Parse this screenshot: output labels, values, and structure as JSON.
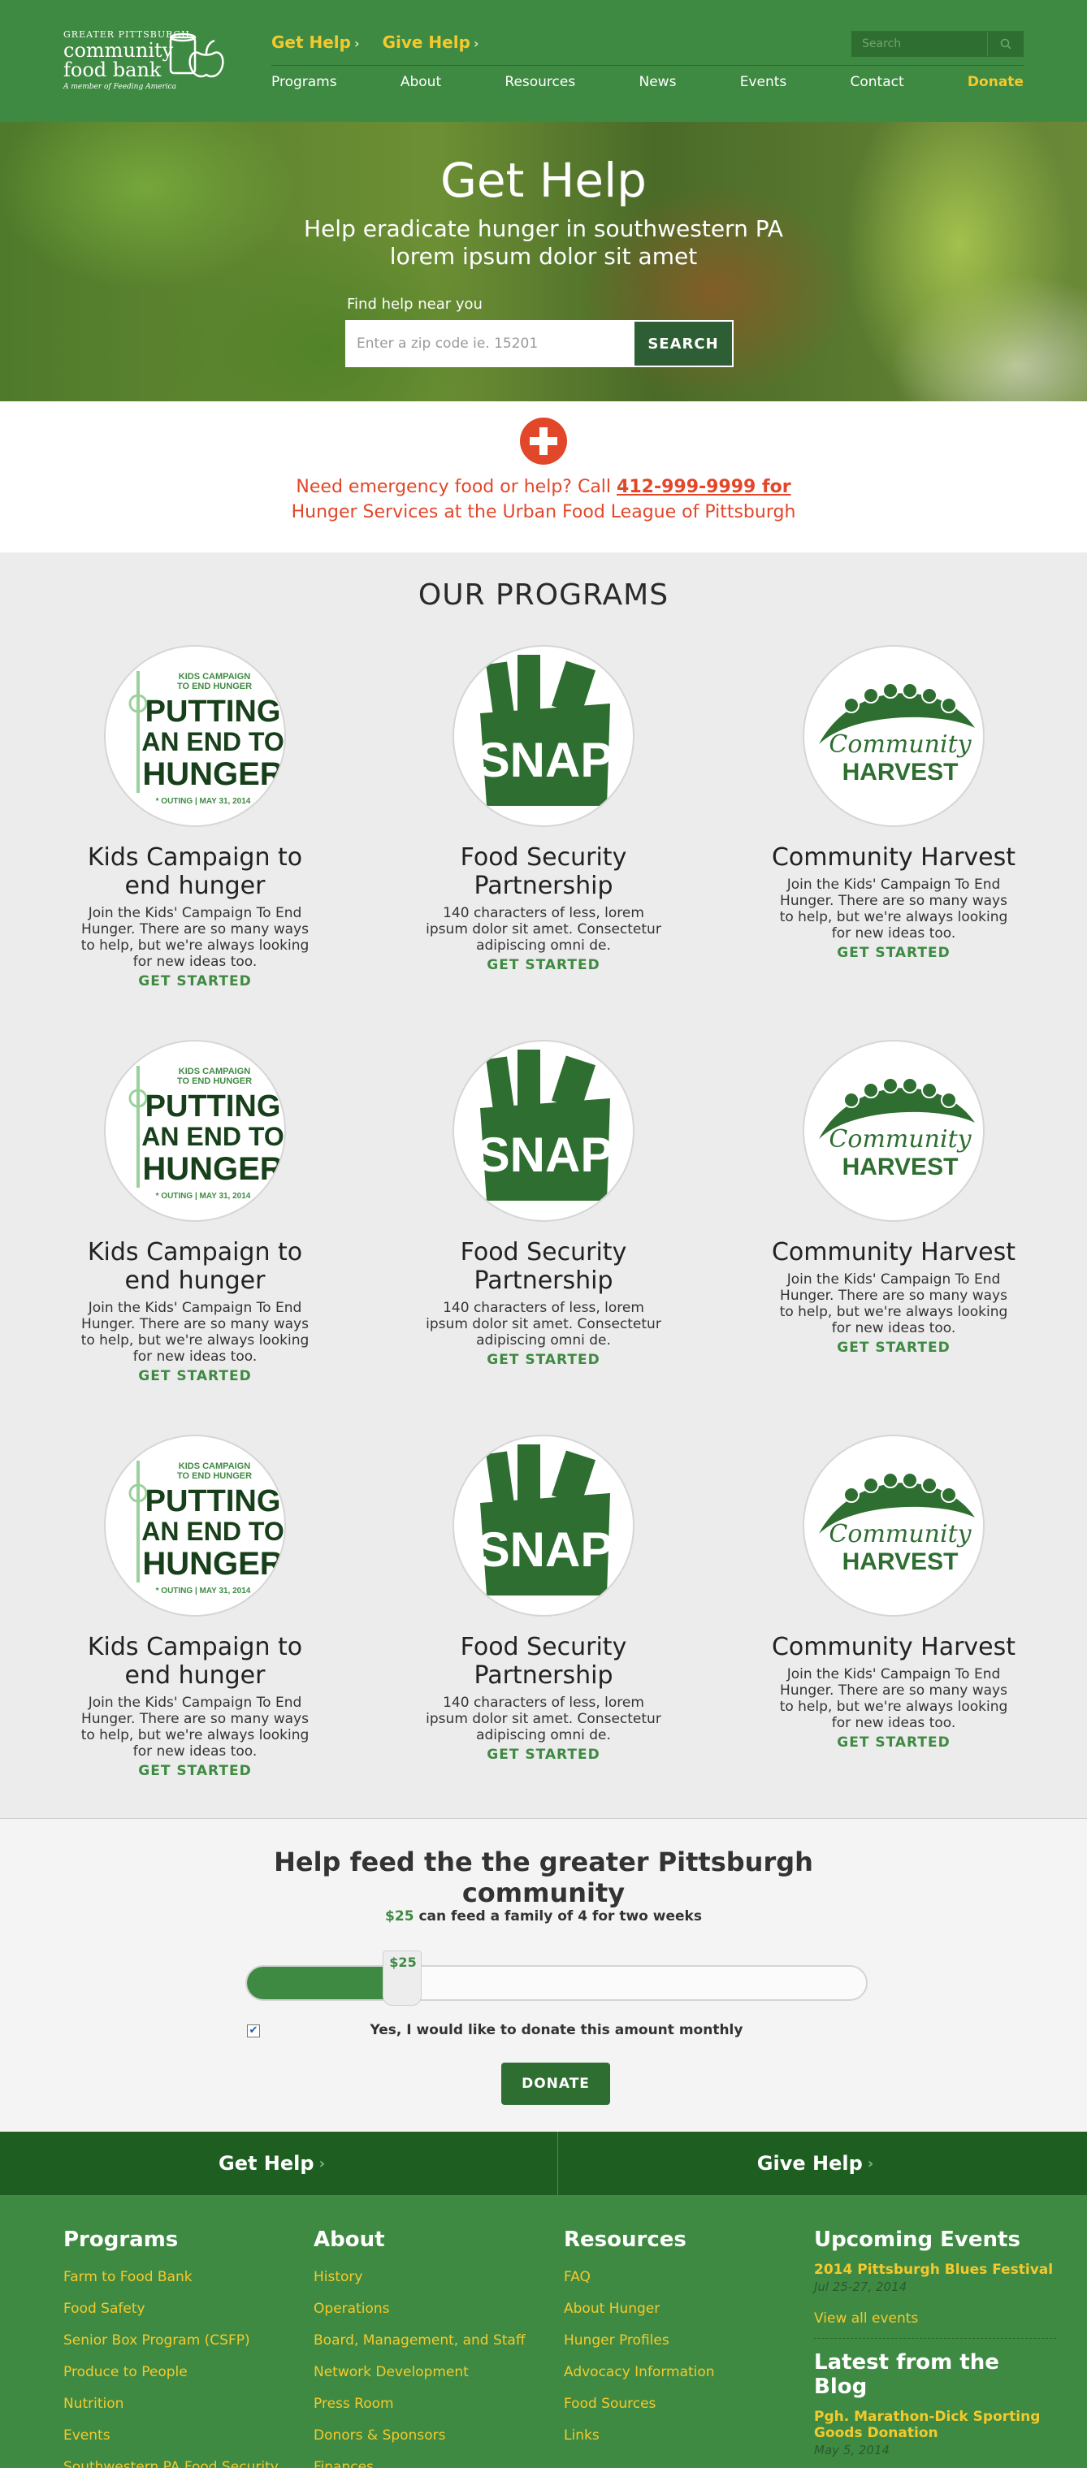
{
  "logo": {
    "line1": "GREATER PITTSBURGH",
    "line2": "community",
    "line3": "food bank",
    "tagline": "A member of Feeding America"
  },
  "top_links": [
    {
      "label": "Get Help"
    },
    {
      "label": "Give Help"
    }
  ],
  "search": {
    "placeholder": "Search"
  },
  "nav": [
    {
      "label": "Programs"
    },
    {
      "label": "About"
    },
    {
      "label": "Resources"
    },
    {
      "label": "News"
    },
    {
      "label": "Events"
    },
    {
      "label": "Contact"
    },
    {
      "label": "Donate"
    }
  ],
  "hero": {
    "title": "Get Help",
    "subtitle_line1": "Help eradicate hunger in southwestern PA",
    "subtitle_line2": "lorem ipsum dolor sit amet",
    "find_label": "Find help near you",
    "zip_placeholder": "Enter a zip code ie. 15201",
    "search_button": "SEARCH"
  },
  "emergency": {
    "text_before": "Need emergency food or help? Call ",
    "phone": "412-999-9999 for",
    "line2": "Hunger Services at the Urban Food League of Pittsburgh"
  },
  "programs": {
    "heading": "OUR PROGRAMS",
    "cta": "GET STARTED",
    "logo_kids": {
      "line1": "KIDS CAMPAIGN",
      "line2": "TO END HUNGER",
      "line3": "PUTTING",
      "line4": "AN END TO",
      "line5": "HUNGER",
      "line6": "* OUTING | MAY 31, 2014"
    },
    "logo_snap": "SNAP",
    "logo_harvest": {
      "line1": "Community",
      "line2": "HARVEST"
    },
    "cards": [
      {
        "title": "Kids Campaign to end hunger",
        "desc": "Join the Kids' Campaign To End Hunger. There are so many ways to help, but we're always looking for new ideas too."
      },
      {
        "title": "Food Security Partnership",
        "desc": "140 characters of less, lorem ipsum dolor sit amet. Consectetur adipiscing omni de."
      },
      {
        "title": "Community Harvest",
        "desc": "Join the Kids' Campaign To End Hunger. There are so many ways to help, but we're always looking for new ideas too."
      }
    ]
  },
  "donate": {
    "heading_line1": "Help feed the the greater Pittsburgh",
    "heading_line2": "community",
    "amount": "$25",
    "feed_text": " can feed a family of 4 for two weeks",
    "slider_label": "$25",
    "slider_fraction": 0.25,
    "monthly_label": "Yes, I would like to donate this amount monthly",
    "monthly_checked": true,
    "button": "DONATE"
  },
  "band": {
    "left": "Get Help",
    "right": "Give Help"
  },
  "footer": {
    "programs": {
      "heading": "Programs",
      "links": [
        "Farm to Food Bank",
        "Food Safety",
        "Senior Box Program (CSFP)",
        "Produce to People",
        "Nutrition",
        "Events",
        "Southwestern PA Food Security"
      ]
    },
    "about": {
      "heading": "About",
      "links": [
        "History",
        "Operations",
        "Board, Management, and Staff",
        "Network Development",
        "Press Room",
        "Donors & Sponsors",
        "Finances"
      ]
    },
    "resources": {
      "heading": "Resources",
      "links": [
        "FAQ",
        "About Hunger",
        "Hunger Profiles",
        "Advocacy Information",
        "Food Sources",
        "Links"
      ]
    },
    "events": {
      "heading": "Upcoming Events",
      "event_title": "2014 Pittsburgh Blues Festival",
      "event_date": "Jul 25-27, 2014",
      "view_all": "View all events"
    },
    "blog": {
      "heading": "Latest from the Blog",
      "post_title_line1": "Pgh. Marathon-Dick Sporting",
      "post_title_line2": "Goods Donation",
      "post_date": "May 5, 2014"
    }
  },
  "colors": {
    "brand_green": "#3f8a42",
    "dark_green": "#2e6e31",
    "accent_yellow": "#f4c92d",
    "emergency_red": "#e2472a"
  }
}
